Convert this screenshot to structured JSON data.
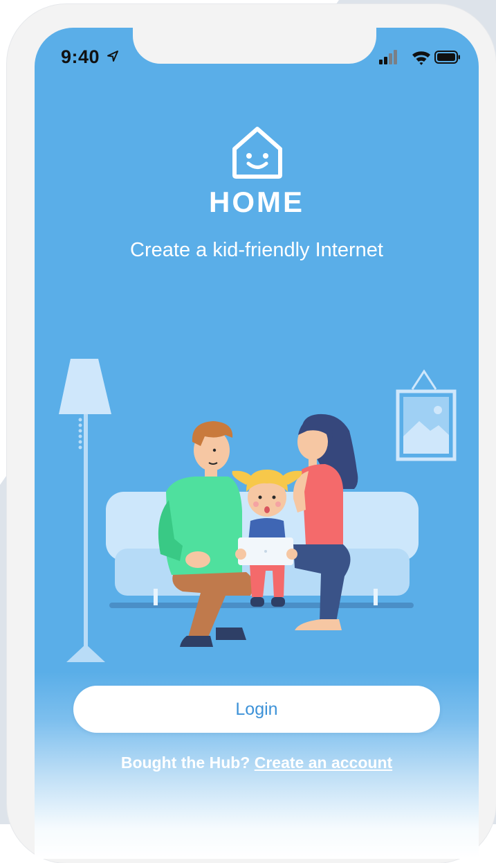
{
  "status_bar": {
    "time": "9:40",
    "icons": [
      "location-arrow-icon",
      "cellular-signal-icon",
      "wifi-icon",
      "battery-icon"
    ]
  },
  "brand": {
    "logo_icon": "smiling-house-icon",
    "name": "HOME",
    "tagline": "Create a kid-friendly Internet"
  },
  "illustration": {
    "subject": "family-on-sofa-illustration"
  },
  "actions": {
    "login_label": "Login",
    "signup_prompt": "Bought the Hub?",
    "signup_link": "Create an account"
  },
  "colors": {
    "screen_background": "#5aaee8",
    "button_text": "#3d92d8",
    "text": "#ffffff"
  }
}
